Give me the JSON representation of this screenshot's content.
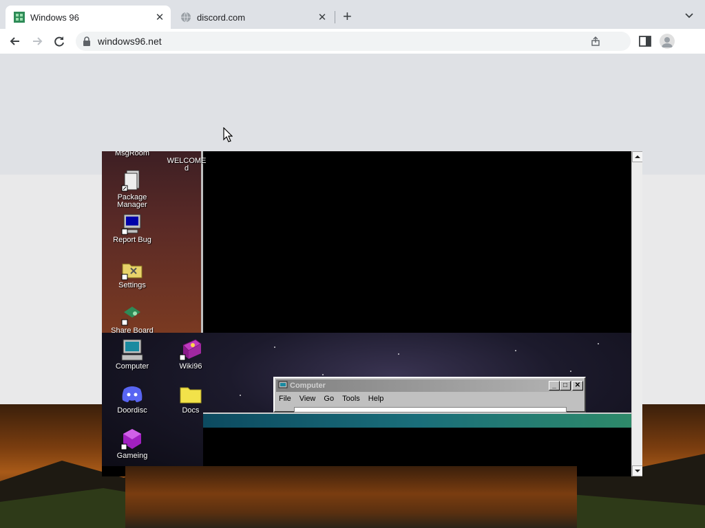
{
  "browser": {
    "tabs": [
      {
        "title": "Windows 96",
        "active": true
      },
      {
        "title": "discord.com",
        "active": false
      }
    ],
    "new_tab": "+",
    "close_glyph": "✕",
    "url": "windows96.net"
  },
  "desktop": {
    "top_icons": [
      {
        "label": "MsgRoom"
      },
      {
        "label": "WELCOME\nd"
      },
      {
        "label": "Package Manager"
      },
      {
        "label": "Report Bug"
      },
      {
        "label": "Settings"
      },
      {
        "label": "Share Board"
      }
    ],
    "bottom_icons": [
      {
        "label": "Computer"
      },
      {
        "label": "Wiki96"
      },
      {
        "label": "Doordisc"
      },
      {
        "label": "Docs"
      },
      {
        "label": "Gameing"
      }
    ]
  },
  "window": {
    "title": "Computer",
    "menu": [
      "File",
      "View",
      "Go",
      "Tools",
      "Help"
    ],
    "buttons": [
      "_",
      "□",
      "✕"
    ]
  },
  "colors": {
    "chrome_bg": "#dee1e6",
    "teal_bar": "#1a6e7a",
    "desktop_maroon": "#5a2a26"
  }
}
